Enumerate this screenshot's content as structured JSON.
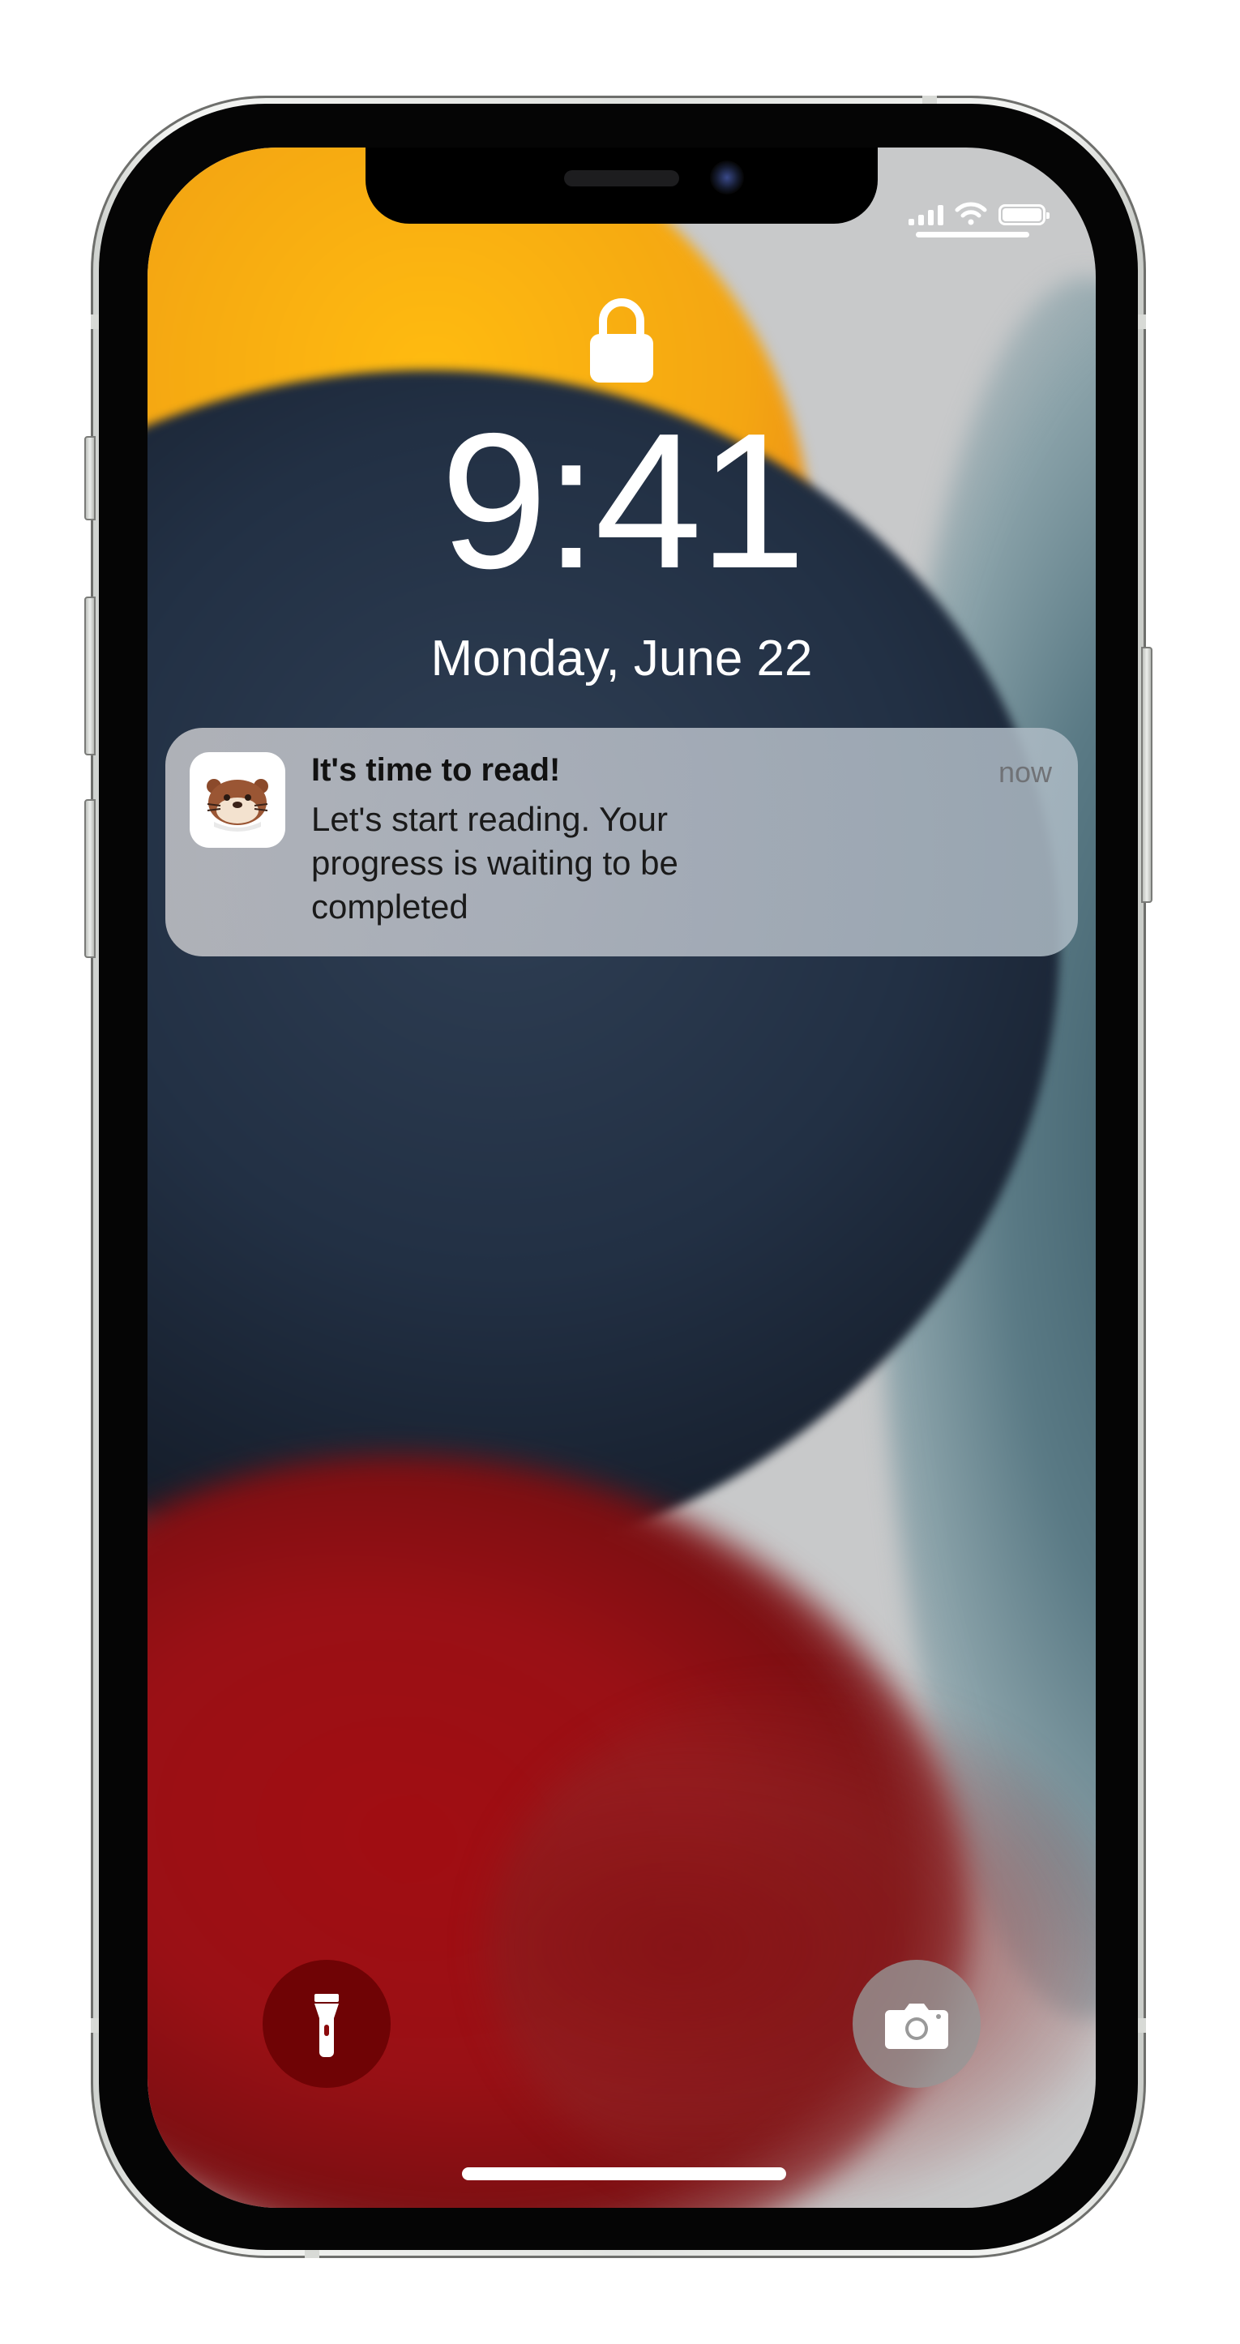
{
  "lock_screen": {
    "time": "9:41",
    "date": "Monday, June 22"
  },
  "notification": {
    "app_icon": "otter-reading-app-icon",
    "title": "It's time to read!",
    "timestamp": "now",
    "body": "Let's start reading. Your progress is waiting to be completed"
  },
  "status_bar": {
    "icons": [
      "cellular-signal-icon",
      "wifi-icon",
      "battery-icon"
    ]
  },
  "quick_actions": {
    "left_icon": "flashlight-icon",
    "right_icon": "camera-icon"
  },
  "colors": {
    "flashlight_button": "#6f0305",
    "camera_button": "#969696",
    "notification_title": "#111111",
    "notification_timestamp": "#707276"
  }
}
